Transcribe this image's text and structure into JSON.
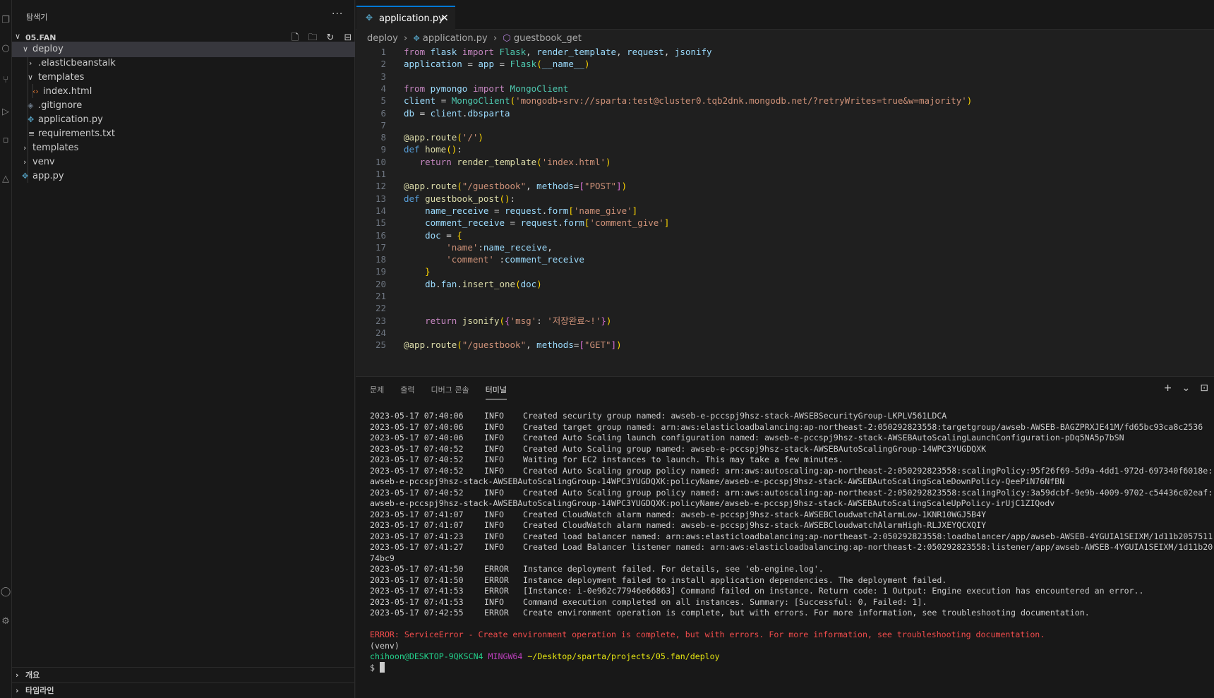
{
  "explorer": {
    "title": "탐색기",
    "more_label": "···",
    "root_folder": "05.FAN",
    "tree": [
      {
        "label": "deploy",
        "type": "folder",
        "expanded": true,
        "selected": true
      },
      {
        "label": ".elasticbeanstalk",
        "type": "folder",
        "expanded": false
      },
      {
        "label": "templates",
        "type": "folder",
        "expanded": true
      },
      {
        "label": "index.html",
        "type": "html"
      },
      {
        "label": ".gitignore",
        "type": "gitignore"
      },
      {
        "label": "application.py",
        "type": "python"
      },
      {
        "label": "requirements.txt",
        "type": "text"
      },
      {
        "label": "templates",
        "type": "folder",
        "expanded": false
      },
      {
        "label": "venv",
        "type": "folder",
        "expanded": false
      },
      {
        "label": "app.py",
        "type": "python"
      }
    ],
    "outline_label": "개요",
    "timeline_label": "타임라인"
  },
  "editor": {
    "tab_label": "application.py",
    "tab_close": "✕",
    "breadcrumb": [
      "deploy",
      "application.py",
      "guestbook_get"
    ],
    "lines": [
      "from flask import Flask, render_template, request, jsonify",
      "application = app = Flask(__name__)",
      "",
      "from pymongo import MongoClient",
      "client = MongoClient('mongodb+srv://sparta:test@cluster0.tqb2dnk.mongodb.net/?retryWrites=true&w=majority')",
      "db = client.dbsparta",
      "",
      "@app.route('/')",
      "def home():",
      "   return render_template('index.html')",
      "",
      "@app.route(\"/guestbook\", methods=[\"POST\"])",
      "def guestbook_post():",
      "    name_receive = request.form['name_give']",
      "    comment_receive = request.form['comment_give']",
      "    doc = {",
      "        'name':name_receive,",
      "        'comment' :comment_receive",
      "    }",
      "    db.fan.insert_one(doc)",
      "",
      "",
      "    return jsonify({'msg': '저장완료~!'})",
      "",
      "@app.route(\"/guestbook\", methods=[\"GET\"])"
    ]
  },
  "panel": {
    "tabs": [
      "문제",
      "출력",
      "디버그 콘솔",
      "터미널"
    ],
    "active_tab": "터미널",
    "add_label": "+",
    "dropdown_label": "⌄",
    "logs": [
      {
        "ts": "2023-05-17 07:40:06",
        "level": "INFO",
        "msg": "Created security group named: awseb-e-pccspj9hsz-stack-AWSEBSecurityGroup-LKPLV561LDCA"
      },
      {
        "ts": "2023-05-17 07:40:06",
        "level": "INFO",
        "msg": "Created target group named: arn:aws:elasticloadbalancing:ap-northeast-2:050292823558:targetgroup/awseb-AWSEB-BAGZPRXJE41M/fd65bc93ca8c2536"
      },
      {
        "ts": "2023-05-17 07:40:06",
        "level": "INFO",
        "msg": "Created Auto Scaling launch configuration named: awseb-e-pccspj9hsz-stack-AWSEBAutoScalingLaunchConfiguration-pDq5NA5p7bSN"
      },
      {
        "ts": "2023-05-17 07:40:52",
        "level": "INFO",
        "msg": "Created Auto Scaling group named: awseb-e-pccspj9hsz-stack-AWSEBAutoScalingGroup-14WPC3YUGDQXK"
      },
      {
        "ts": "2023-05-17 07:40:52",
        "level": "INFO",
        "msg": "Waiting for EC2 instances to launch. This may take a few minutes."
      },
      {
        "ts": "2023-05-17 07:40:52",
        "level": "INFO",
        "msg": "Created Auto Scaling group policy named: arn:aws:autoscaling:ap-northeast-2:050292823558:scalingPolicy:95f26f69-5d9a-4dd1-972d-697340f6018e:",
        "cont": "awseb-e-pccspj9hsz-stack-AWSEBAutoScalingGroup-14WPC3YUGDQXK:policyName/awseb-e-pccspj9hsz-stack-AWSEBAutoScalingScaleDownPolicy-QeePiN76NfBN"
      },
      {
        "ts": "2023-05-17 07:40:52",
        "level": "INFO",
        "msg": "Created Auto Scaling group policy named: arn:aws:autoscaling:ap-northeast-2:050292823558:scalingPolicy:3a59dcbf-9e9b-4009-9702-c54436c02eaf:",
        "cont": "awseb-e-pccspj9hsz-stack-AWSEBAutoScalingGroup-14WPC3YUGDQXK:policyName/awseb-e-pccspj9hsz-stack-AWSEBAutoScalingScaleUpPolicy-irUjC1ZIQodv"
      },
      {
        "ts": "2023-05-17 07:41:07",
        "level": "INFO",
        "msg": "Created CloudWatch alarm named: awseb-e-pccspj9hsz-stack-AWSEBCloudwatchAlarmLow-1KNR10WGJ5B4Y"
      },
      {
        "ts": "2023-05-17 07:41:07",
        "level": "INFO",
        "msg": "Created CloudWatch alarm named: awseb-e-pccspj9hsz-stack-AWSEBCloudwatchAlarmHigh-RLJXEYQCXQIY"
      },
      {
        "ts": "2023-05-17 07:41:23",
        "level": "INFO",
        "msg": "Created load balancer named: arn:aws:elasticloadbalancing:ap-northeast-2:050292823558:loadbalancer/app/awseb-AWSEB-4YGUIA1SEIXM/1d11b2057511"
      },
      {
        "ts": "2023-05-17 07:41:27",
        "level": "INFO",
        "msg": "Created Load Balancer listener named: arn:aws:elasticloadbalancing:ap-northeast-2:050292823558:listener/app/awseb-AWSEB-4YGUIA1SEIXM/1d11b20",
        "cont": "74bc9"
      },
      {
        "ts": "2023-05-17 07:41:50",
        "level": "ERROR",
        "msg": "Instance deployment failed. For details, see 'eb-engine.log'."
      },
      {
        "ts": "2023-05-17 07:41:50",
        "level": "ERROR",
        "msg": "Instance deployment failed to install application dependencies. The deployment failed."
      },
      {
        "ts": "2023-05-17 07:41:53",
        "level": "ERROR",
        "msg": "[Instance: i-0e962c77946e66863] Command failed on instance. Return code: 1 Output: Engine execution has encountered an error.."
      },
      {
        "ts": "2023-05-17 07:41:53",
        "level": "INFO",
        "msg": "Command execution completed on all instances. Summary: [Successful: 0, Failed: 1]."
      },
      {
        "ts": "2023-05-17 07:42:55",
        "level": "ERROR",
        "msg": "Create environment operation is complete, but with errors. For more information, see troubleshooting documentation."
      }
    ],
    "error_summary": "ERROR: ServiceError - Create environment operation is complete, but with errors. For more information, see troubleshooting documentation.",
    "venv_line": "(venv)",
    "prompt_user": "chihoon@DESKTOP-9QKSCN4",
    "prompt_shell": "MINGW64",
    "prompt_path": "~/Desktop/sparta/projects/05.fan/deploy",
    "prompt_symbol": "$"
  },
  "colors": {
    "accent": "#0078d4",
    "error": "#f14c4c",
    "python_icon": "#519aba",
    "html_icon": "#e37933"
  }
}
